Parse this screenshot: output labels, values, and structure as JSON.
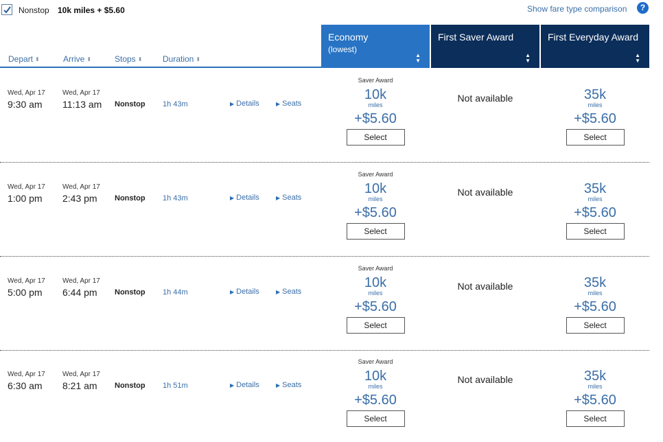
{
  "filter": {
    "nonstop_label": "Nonstop",
    "nonstop_checked": true,
    "nonstop_price": "10k miles + $5.60",
    "compare_link": "Show fare type comparison",
    "help": "?"
  },
  "columns": {
    "depart": "Depart",
    "arrive": "Arrive",
    "stops": "Stops",
    "duration": "Duration",
    "sort_icon": "⬍"
  },
  "cabins": [
    {
      "title": "Economy",
      "subtitle": "(lowest)",
      "color": "#2873c4"
    },
    {
      "title": "First Saver Award",
      "subtitle": "",
      "color": "#0b2e5a"
    },
    {
      "title": "First Everyday Award",
      "subtitle": "",
      "color": "#0b2e5a"
    }
  ],
  "labels": {
    "details": "Details",
    "seats": "Seats",
    "select": "Select",
    "miles": "miles",
    "saver_award": "Saver Award",
    "not_available": "Not available"
  },
  "flights": [
    {
      "depart_date": "Wed, Apr 17",
      "depart_time": "9:30 am",
      "arrive_date": "Wed, Apr 17",
      "arrive_time": "11:13 am",
      "stops": "Nonstop",
      "duration": "1h 43m",
      "economy": {
        "miles": "10k",
        "price": "+$5.60"
      },
      "first_saver": "Not available",
      "first_everyday": {
        "miles": "35k",
        "price": "+$5.60"
      }
    },
    {
      "depart_date": "Wed, Apr 17",
      "depart_time": "1:00 pm",
      "arrive_date": "Wed, Apr 17",
      "arrive_time": "2:43 pm",
      "stops": "Nonstop",
      "duration": "1h 43m",
      "economy": {
        "miles": "10k",
        "price": "+$5.60"
      },
      "first_saver": "Not available",
      "first_everyday": {
        "miles": "35k",
        "price": "+$5.60"
      }
    },
    {
      "depart_date": "Wed, Apr 17",
      "depart_time": "5:00 pm",
      "arrive_date": "Wed, Apr 17",
      "arrive_time": "6:44 pm",
      "stops": "Nonstop",
      "duration": "1h 44m",
      "economy": {
        "miles": "10k",
        "price": "+$5.60"
      },
      "first_saver": "Not available",
      "first_everyday": {
        "miles": "35k",
        "price": "+$5.60"
      }
    },
    {
      "depart_date": "Wed, Apr 17",
      "depart_time": "6:30 am",
      "arrive_date": "Wed, Apr 17",
      "arrive_time": "8:21 am",
      "stops": "Nonstop",
      "duration": "1h 51m",
      "economy": {
        "miles": "10k",
        "price": "+$5.60"
      },
      "first_saver": "Not available",
      "first_everyday": {
        "miles": "35k",
        "price": "+$5.60"
      }
    }
  ]
}
